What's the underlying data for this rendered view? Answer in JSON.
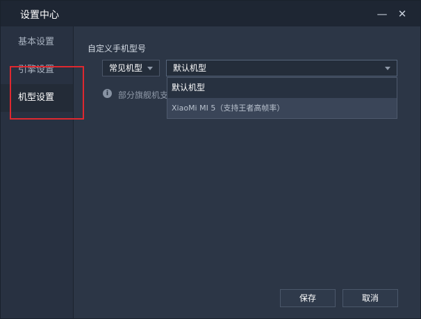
{
  "window": {
    "title": "设置中心",
    "minimize_glyph": "—",
    "close_glyph": "✕"
  },
  "sidebar": {
    "items": [
      {
        "label": "基本设置"
      },
      {
        "label": "引擎设置"
      },
      {
        "label": "机型设置",
        "active": true
      }
    ]
  },
  "main": {
    "section_label": "自定义手机型号",
    "category_select": {
      "value": "常见机型"
    },
    "model_select": {
      "value": "默认机型",
      "options": [
        {
          "label": "默认机型"
        },
        {
          "label": "XiaoMi MI 5（支持王者高帧率）"
        }
      ]
    },
    "info": {
      "icon": "info-icon",
      "text": "部分旗舰机支"
    },
    "buttons": {
      "save": "保存",
      "cancel": "取消"
    }
  },
  "colors": {
    "background": "#2c3646",
    "titlebar": "#1e2633",
    "highlight_box": "#e0282f"
  }
}
